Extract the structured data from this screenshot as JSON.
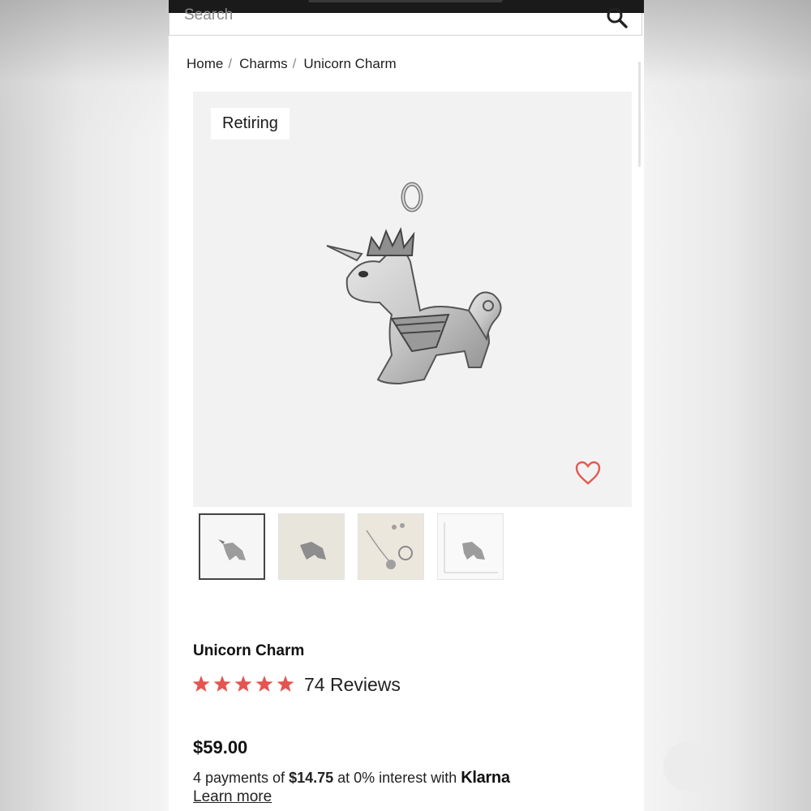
{
  "search": {
    "placeholder": "Search"
  },
  "breadcrumb": {
    "items": [
      "Home",
      "Charms",
      "Unicorn Charm"
    ],
    "separator": "/"
  },
  "product": {
    "badge": "Retiring",
    "title": "Unicorn Charm",
    "rating": 5,
    "reviews_label": "74 Reviews",
    "price": "$59.00",
    "installments": {
      "prefix": "4 payments of ",
      "amount": "$14.75",
      "middle": " at 0% interest with ",
      "provider": "Klarna"
    },
    "learn_more": "Learn more",
    "thumbnail_count": 4
  },
  "colors": {
    "star": "#e4554f",
    "heart": "#e25b52",
    "image_bg": "#f2f2f2"
  },
  "icons": [
    "search-icon",
    "heart-icon",
    "star-icon"
  ]
}
